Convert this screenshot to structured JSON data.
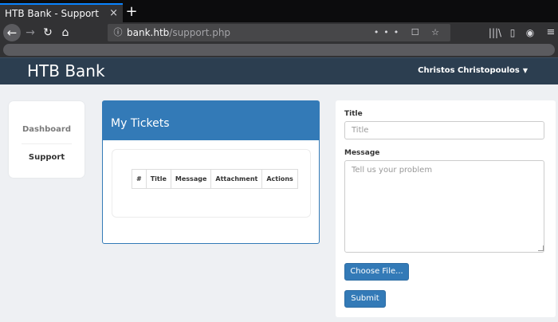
{
  "browser": {
    "tab_title": "HTB Bank - Support",
    "tab_close": "×",
    "new_tab": "+",
    "url_host": "bank.htb",
    "url_path": "/support.php",
    "icons": {
      "back": "←",
      "forward": "→",
      "reload": "↻",
      "home": "⌂",
      "info": "ⓘ",
      "page_actions": "••• ☐ ☆",
      "library": "|||\\",
      "sidebar": "▯",
      "account": "◉",
      "menu": "≡"
    }
  },
  "header": {
    "brand": "HTB Bank",
    "user_name": "Christos Christopoulos",
    "caret": "▼"
  },
  "sidebar": {
    "items": [
      {
        "label": "Dashboard"
      },
      {
        "label": "Support"
      }
    ]
  },
  "tickets": {
    "heading": "My Tickets",
    "columns": [
      "#",
      "Title",
      "Message",
      "Attachment",
      "Actions"
    ]
  },
  "form": {
    "title_label": "Title",
    "title_placeholder": "Title",
    "message_label": "Message",
    "message_placeholder": "Tell us your problem",
    "choose_file_label": "Choose File...",
    "submit_label": "Submit"
  }
}
